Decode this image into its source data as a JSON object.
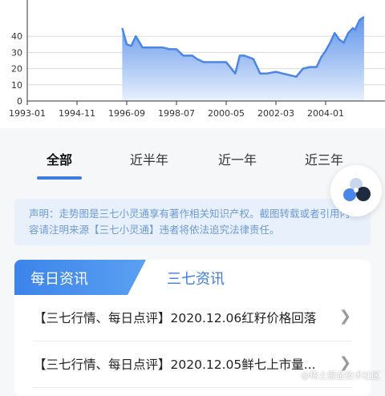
{
  "chart_data": {
    "type": "area",
    "x_ticks": [
      "1993-01",
      "1994-11",
      "1996-09",
      "1998-07",
      "2000-05",
      "2002-03",
      "2004-01"
    ],
    "y_ticks": [
      "0",
      "10",
      "20",
      "30",
      "40"
    ],
    "ylim": [
      0,
      45
    ],
    "grid": true,
    "x": [
      "1993-01",
      "1994-11",
      "1996-03",
      "1996-05",
      "1996-07",
      "1996-09",
      "1996-11",
      "1997-01",
      "1997-04",
      "1998-01",
      "1998-04",
      "1998-07",
      "1998-10",
      "1999-02",
      "1999-04",
      "1999-07",
      "2000-05",
      "2000-09",
      "2000-11",
      "2001-01",
      "2001-05",
      "2001-08",
      "2001-11",
      "2002-03",
      "2002-06",
      "2002-09",
      "2002-12",
      "2003-03",
      "2003-06",
      "2003-09",
      "2003-11",
      "2004-01",
      "2004-03",
      "2004-05",
      "2004-07",
      "2004-09",
      "2004-11",
      "2005-01",
      "2005-02",
      "2005-04",
      "2005-06"
    ],
    "values": [
      null,
      null,
      null,
      null,
      45,
      35,
      34,
      40,
      33,
      33,
      32,
      32,
      28,
      28,
      26,
      24,
      24,
      17,
      28,
      28,
      26,
      17,
      17,
      18,
      17,
      16,
      15,
      20,
      21,
      21,
      27,
      31,
      36,
      42,
      38,
      36,
      42,
      45,
      44,
      50,
      52
    ],
    "fill_colors": [
      "#4a86e8",
      "#eaf1fc"
    ]
  },
  "period_tabs": [
    "全部",
    "近半年",
    "近一年",
    "近三年"
  ],
  "disclaimer": "声明：走势图是三七小灵通享有著作相关知识产权。截图转载或者引用内容请注明来源【三七小灵通】违者将依法追究法律责任。",
  "news": {
    "tab_active": "每日资讯",
    "tab_other": "三七资讯",
    "items": [
      "【三七行情、每日点评】2020.12.06红籽价格回落",
      "【三七行情、每日点评】2020.12.05鲜七上市量..."
    ]
  },
  "watermark": "@稀土掘金技术社区"
}
